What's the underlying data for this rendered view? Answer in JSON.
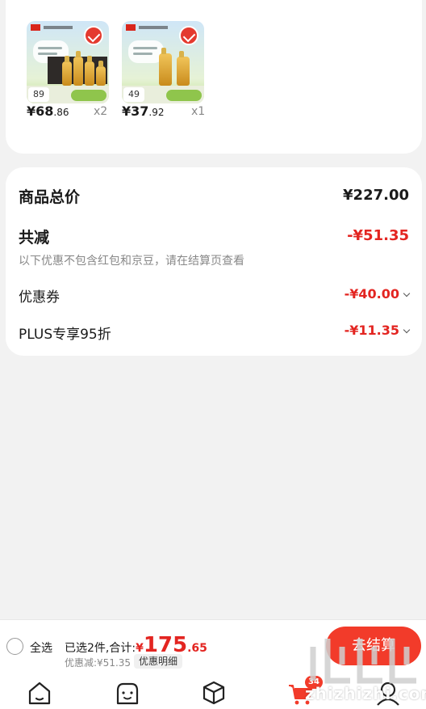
{
  "products": [
    {
      "price_main": "¥68",
      "price_decimal": ".86",
      "quantity": "x2",
      "tag": "89",
      "color_accent": "#e43a2f"
    },
    {
      "price_main": "¥37",
      "price_decimal": ".92",
      "quantity": "x1",
      "tag": "49",
      "color_accent": "#e43a2f"
    }
  ],
  "summary": {
    "total_label": "商品总价",
    "total_value": "¥227.00",
    "reduce_label": "共减",
    "reduce_value": "-¥51.35",
    "note": "以下优惠不包含红包和京豆，请在结算页查看",
    "coupon_label": "优惠券",
    "coupon_value": "-¥40.00",
    "plus_label": "PLUS专享95折",
    "plus_value": "-¥11.35"
  },
  "bottom_bar": {
    "select_all": "全选",
    "selected_prefix": "已选2件,合计:",
    "currency": "¥",
    "total_int": "175",
    "total_dec": ".65",
    "discount_text": "优惠减:¥51.35",
    "detail_button": "优惠明细",
    "checkout_button": "去结算"
  },
  "tabbar": {
    "icons": [
      "home-icon",
      "discover-icon",
      "category-icon",
      "cart-icon",
      "profile-icon"
    ],
    "cart_badge": "34"
  },
  "watermark": {
    "text": "zhizhizhi.com"
  },
  "colors": {
    "accent": "#f23b2a",
    "price_red": "#e32521"
  }
}
